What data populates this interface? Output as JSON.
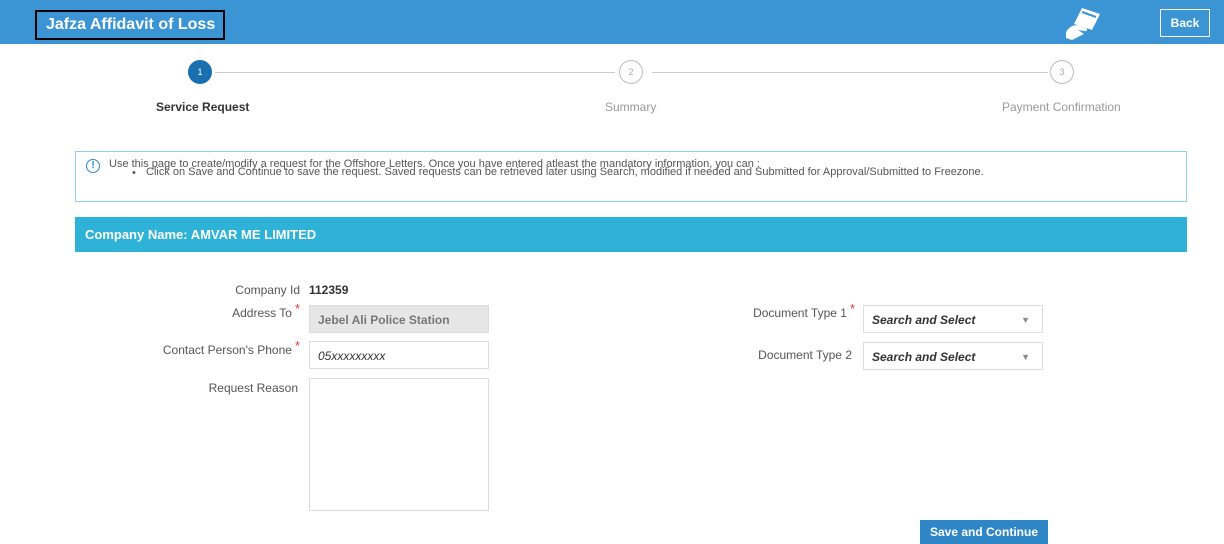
{
  "header": {
    "title": "Jafza Affidavit of Loss",
    "back_label": "Back",
    "accent_color": "#3b95d4"
  },
  "wizard": {
    "steps": [
      {
        "number": "1",
        "label": "Service Request",
        "state": "active"
      },
      {
        "number": "2",
        "label": "Summary",
        "state": "inactive"
      },
      {
        "number": "3",
        "label": "Payment Confirmation",
        "state": "inactive"
      }
    ]
  },
  "info": {
    "icon": "info-circle-icon",
    "text": "Use this page to create/modify a request for the Offshore Letters. Once you have entered atleast the mandatory information, you can :",
    "bullet": "Click on Save and Continue to save the request. Saved requests can be retrieved later using Search, modified if needed and Submitted for Approval/Submitted to Freezone."
  },
  "company": {
    "name_label": "Company Name: AMVAR ME LIMITED",
    "bar_color": "#2fb2d8"
  },
  "form": {
    "company_id_label": "Company Id",
    "company_id_value": "112359",
    "address_to_label": "Address To",
    "address_to_value": "Jebel Ali Police Station",
    "contact_phone_label": "Contact Person's Phone",
    "contact_phone_value": "05xxxxxxxxx",
    "request_reason_label": "Request Reason",
    "request_reason_value": "",
    "doc_type_1_label": "Document Type 1",
    "doc_type_1_value": "Search and Select",
    "doc_type_2_label": "Document Type 2",
    "doc_type_2_value": "Search and Select"
  },
  "actions": {
    "save_label": "Save and Continue"
  }
}
